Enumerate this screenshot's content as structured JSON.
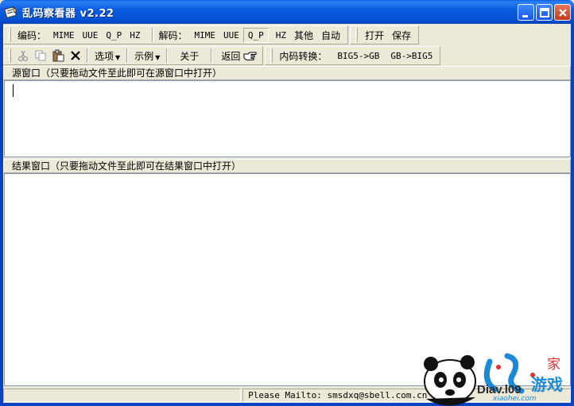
{
  "window": {
    "title": "乱码察看器 v2.22"
  },
  "toolbar1": {
    "encode_label": "编码：",
    "encode_buttons": [
      "MIME",
      "UUE",
      "Q_P",
      "HZ"
    ],
    "decode_label": "解码：",
    "decode_buttons": [
      "MIME",
      "UUE",
      "Q_P",
      "HZ",
      "其他",
      "自动"
    ],
    "file_buttons": [
      "打开",
      "保存"
    ]
  },
  "toolbar2": {
    "options": "选项",
    "examples": "示例",
    "about": "关于",
    "back": "返回",
    "convert_label": "内码转换：",
    "convert_buttons": [
      "BIG5->GB",
      "GB->BIG5"
    ]
  },
  "source": {
    "header": "源窗口（只要拖动文件至此即可在源窗口中打开）",
    "value": ""
  },
  "result": {
    "header": "结果窗口（只要拖动文件至此即可在结果窗口中打开）",
    "value": ""
  },
  "status": {
    "text": "Please Mailto: smsdxq@sbell.com.cn"
  },
  "watermark": {
    "text1": "Diav.l09 ",
    "text2": "游戏",
    "text3": "家",
    "url": "xiaohei.com"
  },
  "colors": {
    "titlebar": "#0653d6",
    "face": "#ece9d8",
    "close": "#c43a1b"
  }
}
